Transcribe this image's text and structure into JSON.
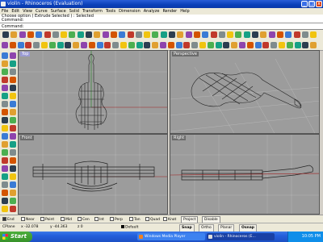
{
  "window": {
    "title": "violin - Rhinoceros (Evaluation)",
    "minimize_glyph": "_",
    "maximize_glyph": "□",
    "close_glyph": "x"
  },
  "menu": [
    "File",
    "Edit",
    "View",
    "Curve",
    "Surface",
    "Solid",
    "Transform",
    "Tools",
    "Dimension",
    "Analyze",
    "Render",
    "Help"
  ],
  "command": {
    "history": [
      "Choose option ( Extrude Selected ) : Selected",
      "Command:"
    ],
    "prompt": "Command:"
  },
  "viewports": {
    "top": "Top",
    "perspective": "Perspective",
    "front": "Front",
    "right": "Right"
  },
  "osnap": [
    {
      "label": "End",
      "on": true
    },
    {
      "label": "Near",
      "on": false
    },
    {
      "label": "Point",
      "on": false
    },
    {
      "label": "Mid",
      "on": false
    },
    {
      "label": "Cen",
      "on": false
    },
    {
      "label": "Int",
      "on": false
    },
    {
      "label": "Perp",
      "on": false
    },
    {
      "label": "Tan",
      "on": false
    },
    {
      "label": "Quad",
      "on": false
    },
    {
      "label": "Knot",
      "on": false
    }
  ],
  "osnap_buttons": {
    "project": "Project",
    "disable": "Disable"
  },
  "status": {
    "cplane": "CPlane",
    "x": "x -32.078",
    "y": "y -44.363",
    "z": "z 0",
    "layer": "Default",
    "snap": "Snap",
    "ortho": "Ortho",
    "planar": "Planar",
    "osnap": "Osnap"
  },
  "taskbar": {
    "start": "Start",
    "tasks": [
      "Windows Media Player",
      "violin - Rhinoceros (E..."
    ],
    "time": "10:05 PM"
  },
  "colors": {
    "viewport_bg": "#9c9c9c",
    "active_title": "#9b9bd5",
    "xp_blue": "#245edb",
    "start_green": "#37922a"
  }
}
